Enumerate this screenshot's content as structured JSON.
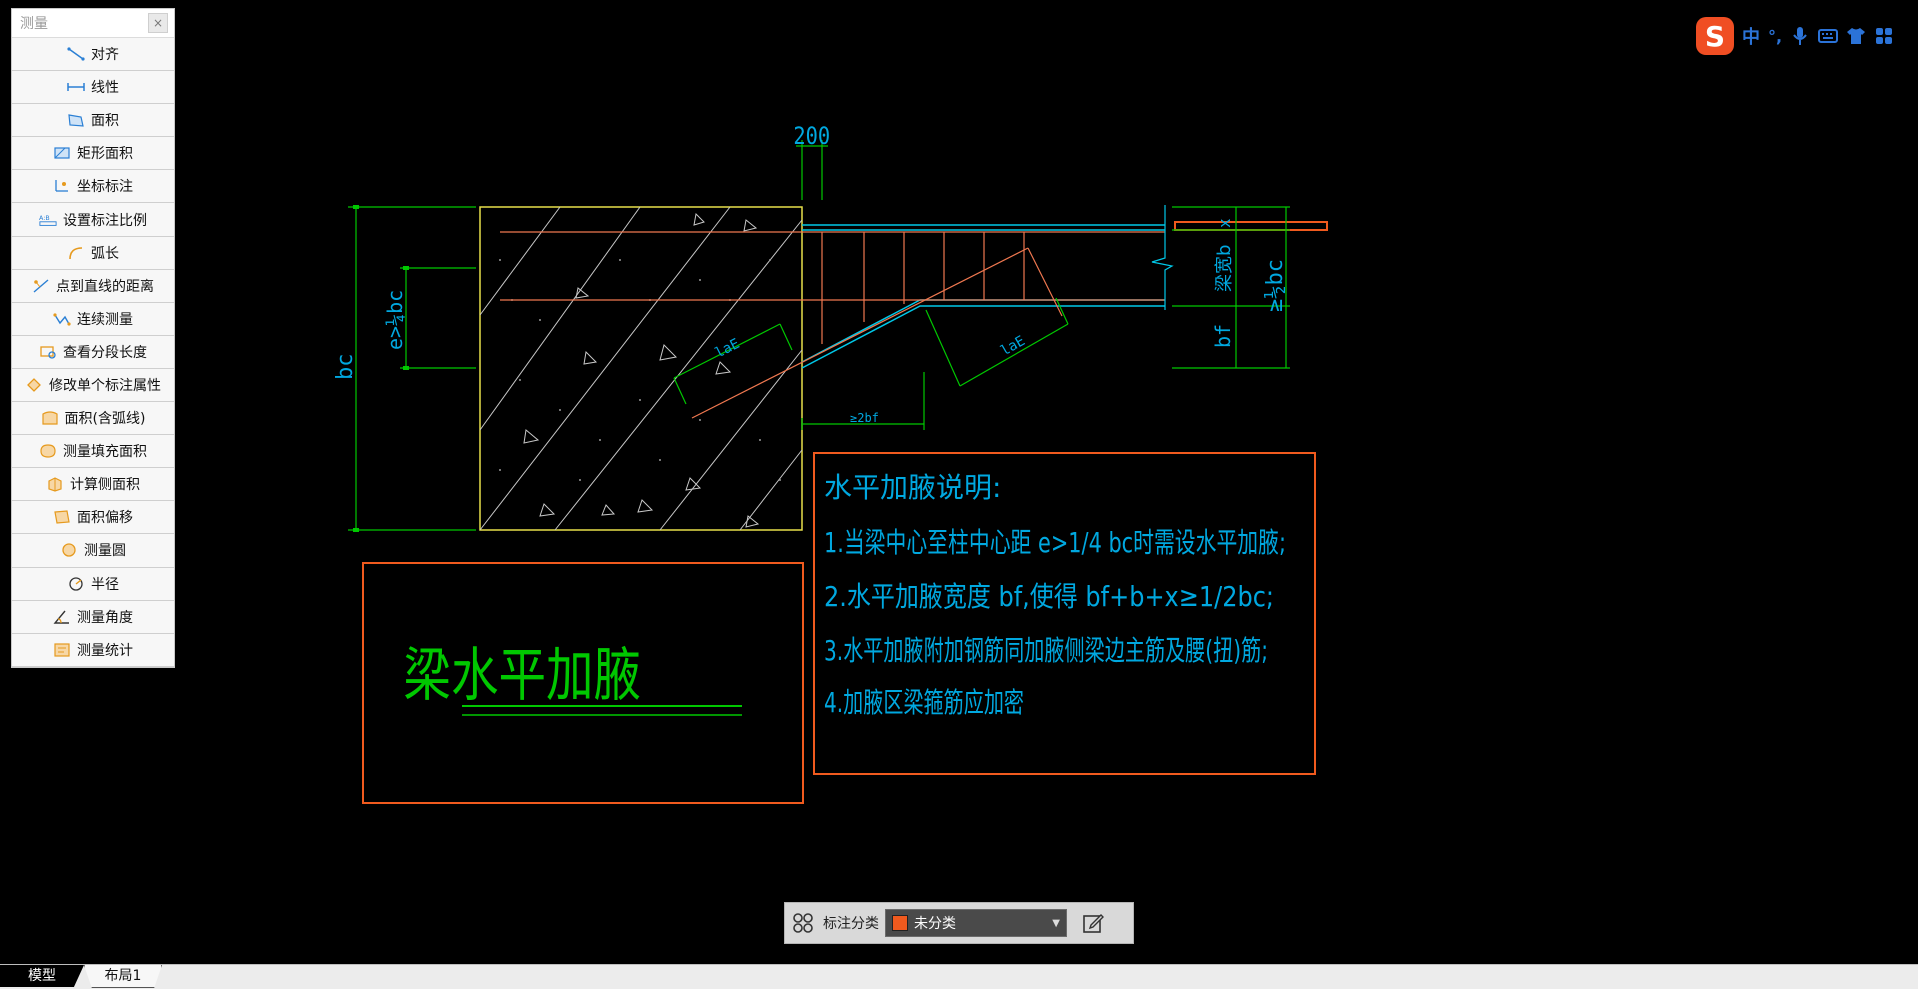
{
  "measure_panel": {
    "title": "测量",
    "close": "×",
    "items": [
      {
        "label": "对齐",
        "icon": "align-measure-icon"
      },
      {
        "label": "线性",
        "icon": "linear-measure-icon"
      },
      {
        "label": "面积",
        "icon": "area-icon"
      },
      {
        "label": "矩形面积",
        "icon": "rect-area-icon"
      },
      {
        "label": "坐标标注",
        "icon": "coordinate-icon"
      },
      {
        "label": "设置标注比例",
        "icon": "scale-icon"
      },
      {
        "label": "弧长",
        "icon": "arc-length-icon"
      },
      {
        "label": "点到直线的距离",
        "icon": "point-line-distance-icon"
      },
      {
        "label": "连续测量",
        "icon": "continuous-measure-icon"
      },
      {
        "label": "查看分段长度",
        "icon": "segment-length-icon"
      },
      {
        "label": "修改单个标注属性",
        "icon": "edit-annotation-icon"
      },
      {
        "label": "面积(含弧线)",
        "icon": "arc-area-icon"
      },
      {
        "label": "测量填充面积",
        "icon": "fill-area-icon"
      },
      {
        "label": "计算侧面积",
        "icon": "side-area-icon"
      },
      {
        "label": "面积偏移",
        "icon": "area-offset-icon"
      },
      {
        "label": "测量圆",
        "icon": "circle-icon"
      },
      {
        "label": "半径",
        "icon": "radius-icon"
      },
      {
        "label": "测量角度",
        "icon": "angle-icon"
      },
      {
        "label": "测量统计",
        "icon": "statistics-icon"
      }
    ]
  },
  "drawing": {
    "dim_top": "200",
    "dim_bc": "bc",
    "dim_e": "e>¼bc",
    "dim_beam_width": "梁宽b",
    "dim_x": "x",
    "dim_bf": "bf",
    "dim_half_bc": "≥½bc",
    "label_laE1": "laE",
    "label_laE2": "laE",
    "label_2bf": "≥2bf",
    "title": "梁水平加腋",
    "notes": {
      "heading": "水平加腋说明:",
      "line1": "1.当梁中心至柱中心距 e>1/4 bc时需设水平加腋;",
      "line2": "2.水平加腋宽度 bf,使得 bf+b+x≥1/2bc;",
      "line3": "3.水平加腋附加钢筋同加腋侧梁边主筋及腰(扭)筋;",
      "line4": "4.加腋区梁箍筋应加密"
    },
    "colors": {
      "dim": "#00c800",
      "text_cyan": "#00a8e0",
      "concrete": "#e8e04a",
      "rebar": "#f07850",
      "frame": "#f05a1e",
      "hatch": "#c8c8c8"
    }
  },
  "anno_bar": {
    "label": "标注分类",
    "selected": "未分类",
    "swatch": "#f05a1e"
  },
  "tabs": [
    {
      "label": "模型",
      "active": true
    },
    {
      "label": "布局1",
      "active": false
    }
  ],
  "ime": {
    "logo": "S",
    "mode": "中",
    "punct": "°,"
  }
}
